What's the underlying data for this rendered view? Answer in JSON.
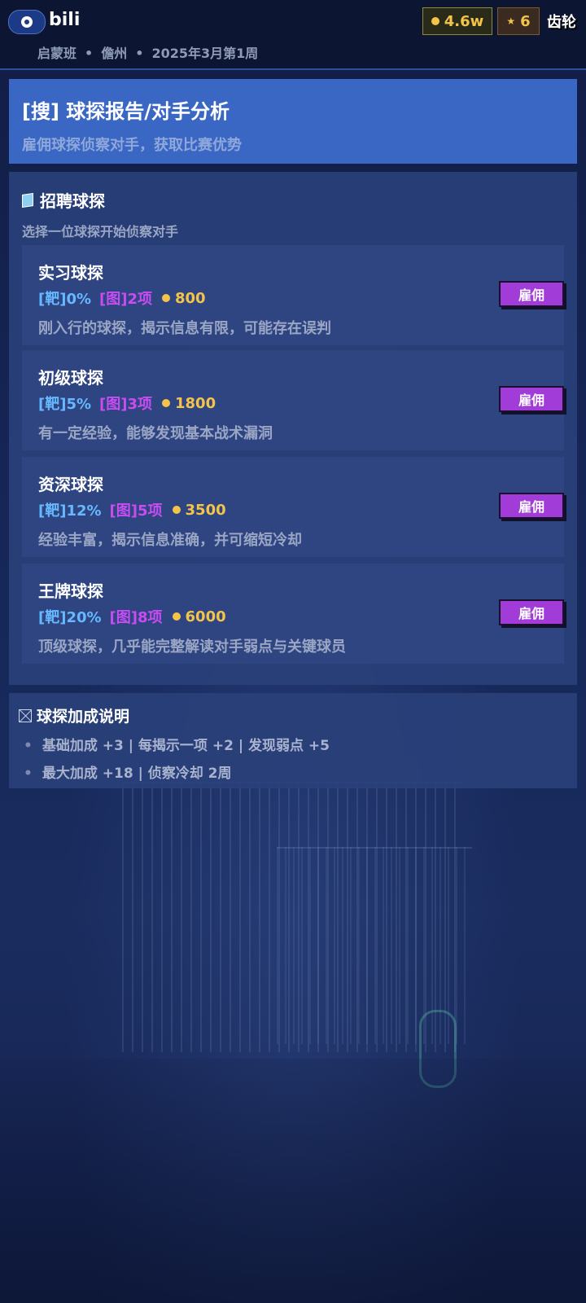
{
  "header": {
    "brand": "bili",
    "subline": [
      "启蒙班",
      "儋州",
      "2025年3月第1周"
    ],
    "coins": "4.6w",
    "stars": "6",
    "settings_label": "齿轮"
  },
  "banner": {
    "title": "[搜] 球探报告/对手分析",
    "subtitle": "雇佣球探侦察对手，获取比赛优势"
  },
  "recruit": {
    "title": "招聘球探",
    "subtitle": "选择一位球探开始侦察对手",
    "hire_label": "雇佣",
    "scouts": [
      {
        "name": "实习球探",
        "accuracy": "[靶]0%",
        "items": "[图]2项",
        "cost": "800",
        "desc": "刚入行的球探，揭示信息有限，可能存在误判"
      },
      {
        "name": "初级球探",
        "accuracy": "[靶]5%",
        "items": "[图]3项",
        "cost": "1800",
        "desc": "有一定经验，能够发现基本战术漏洞"
      },
      {
        "name": "资深球探",
        "accuracy": "[靶]12%",
        "items": "[图]5项",
        "cost": "3500",
        "desc": "经验丰富，揭示信息准确，并可缩短冷却"
      },
      {
        "name": "王牌球探",
        "accuracy": "[靶]20%",
        "items": "[图]8项",
        "cost": "6000",
        "desc": "顶级球探，几乎能完整解读对手弱点与关键球员"
      }
    ]
  },
  "bonus": {
    "title": "球探加成说明",
    "lines": [
      "基础加成 +3 | 每揭示一项 +2 | 发现弱点 +5",
      "最大加成 +18 | 侦察冷却 2周"
    ]
  },
  "colors": {
    "accent_blue": "#3a67c4",
    "hire_purple": "#a23cd8",
    "accuracy_blue": "#66b8ff",
    "items_purple": "#c94cf2",
    "coin_gold": "#f3c34a"
  },
  "icons": {
    "logo": "football-icon",
    "coin": "coin-icon",
    "star": "star-icon",
    "recruit": "book-icon",
    "bonus": "box-x-icon"
  }
}
